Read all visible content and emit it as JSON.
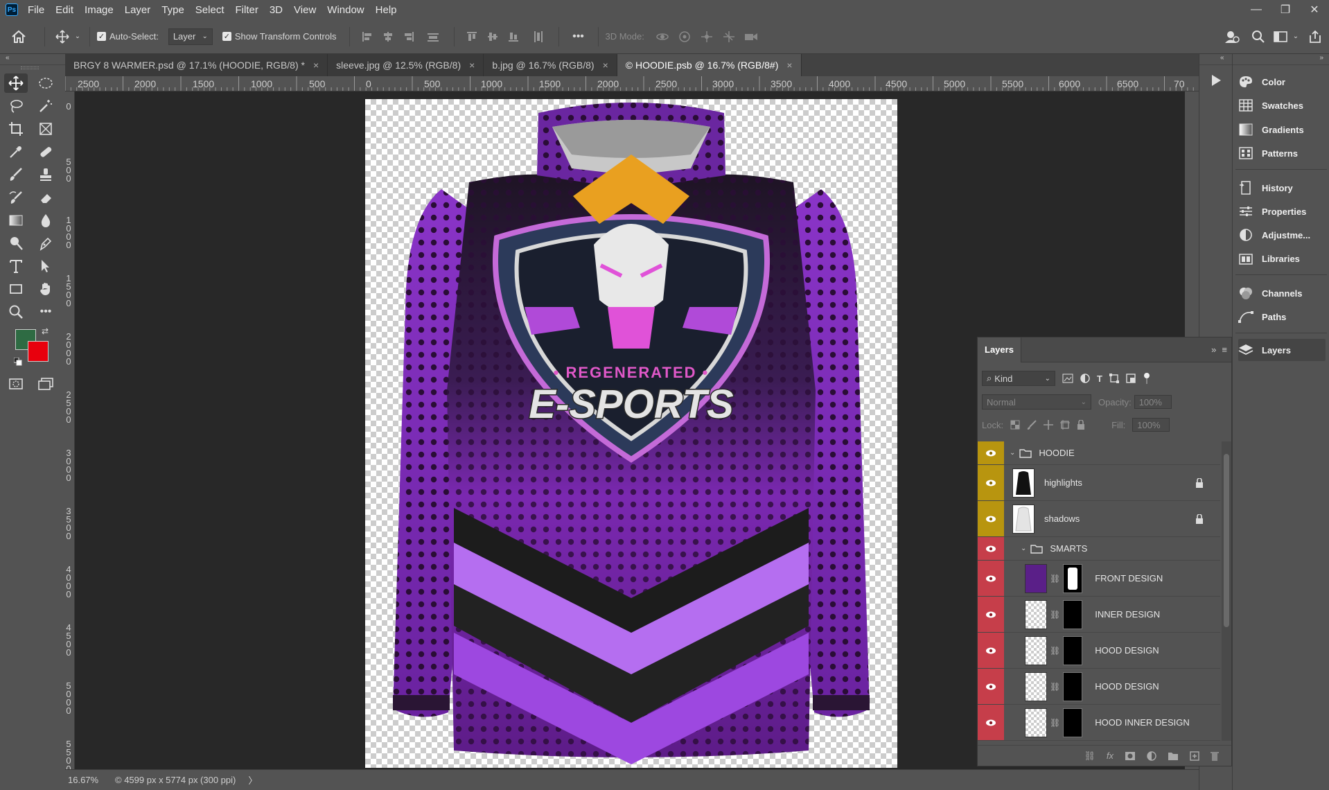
{
  "app": {
    "logo": "Ps"
  },
  "menu": [
    "File",
    "Edit",
    "Image",
    "Layer",
    "Type",
    "Select",
    "Filter",
    "3D",
    "View",
    "Window",
    "Help"
  ],
  "options": {
    "auto_select_label": "Auto-Select:",
    "auto_select_value": "Layer",
    "transform_label": "Show Transform Controls",
    "mode_3d_label": "3D Mode:",
    "more": "•••"
  },
  "tabs": [
    {
      "label": "BRGY 8 WARMER.psd @ 17.1% (HOODIE, RGB/8) *",
      "active": false
    },
    {
      "label": "sleeve.jpg @ 12.5% (RGB/8)",
      "active": false
    },
    {
      "label": "b.jpg @ 16.7% (RGB/8)",
      "active": false
    },
    {
      "label": "© HOODIE.psb @ 16.7% (RGB/8#)",
      "active": true
    }
  ],
  "ruler_top": [
    "2500",
    "2000",
    "1500",
    "1000",
    "500",
    "0",
    "500",
    "1000",
    "1500",
    "2000",
    "2500",
    "3000",
    "3500",
    "4000",
    "4500",
    "5000",
    "5500",
    "6000",
    "6500",
    "70"
  ],
  "ruler_left": [
    "0",
    "5\n0\n0",
    "1\n0\n0\n0",
    "1\n5\n0\n0",
    "2\n0\n0\n0",
    "2\n5\n0\n0",
    "3\n0\n0\n0",
    "3\n5\n0\n0",
    "4\n0\n0\n0",
    "4\n5\n0\n0",
    "5\n0\n0\n0",
    "5\n5\n0\n0"
  ],
  "status": {
    "zoom": "16.67%",
    "doc_info": "© 4599 px x 5774 px (300 ppi)",
    "arrow": "〉"
  },
  "colors": {
    "foreground": "#2e6b43",
    "background": "#e8000d"
  },
  "design": {
    "line1": "• REGENERATED •",
    "line2": "E-SPORTS"
  },
  "panels": [
    {
      "label": "Color",
      "icon": "color-palette-icon"
    },
    {
      "label": "Swatches",
      "icon": "swatches-grid-icon"
    },
    {
      "label": "Gradients",
      "icon": "gradient-icon"
    },
    {
      "label": "Patterns",
      "icon": "patterns-icon"
    },
    {
      "label": "History",
      "icon": "history-icon"
    },
    {
      "label": "Properties",
      "icon": "properties-sliders-icon"
    },
    {
      "label": "Adjustme...",
      "icon": "adjustments-icon"
    },
    {
      "label": "Libraries",
      "icon": "libraries-icon"
    },
    {
      "label": "Channels",
      "icon": "channels-icon"
    },
    {
      "label": "Paths",
      "icon": "paths-icon"
    },
    {
      "label": "Layers",
      "icon": "layers-icon"
    }
  ],
  "layers_panel": {
    "title": "Layers",
    "filter_kind": "Kind",
    "blend_mode": "Normal",
    "opacity_label": "Opacity:",
    "opacity_value": "100%",
    "lock_label": "Lock:",
    "fill_label": "Fill:",
    "fill_value": "100%",
    "layers": [
      {
        "name": "HOODIE",
        "type": "group",
        "eye": "yellow"
      },
      {
        "name": "highlights",
        "type": "layer",
        "eye": "yellow",
        "locked": true
      },
      {
        "name": "shadows",
        "type": "layer",
        "eye": "yellow",
        "locked": true
      },
      {
        "name": "SMARTS",
        "type": "group",
        "eye": "red"
      },
      {
        "name": "FRONT DESIGN",
        "type": "smart",
        "eye": "red"
      },
      {
        "name": "INNER DESIGN",
        "type": "smart",
        "eye": "red"
      },
      {
        "name": "HOOD DESIGN",
        "type": "smart",
        "eye": "red"
      },
      {
        "name": "HOOD DESIGN",
        "type": "smart",
        "eye": "red"
      },
      {
        "name": "HOOD INNER DESIGN",
        "type": "smart",
        "eye": "red"
      }
    ]
  }
}
